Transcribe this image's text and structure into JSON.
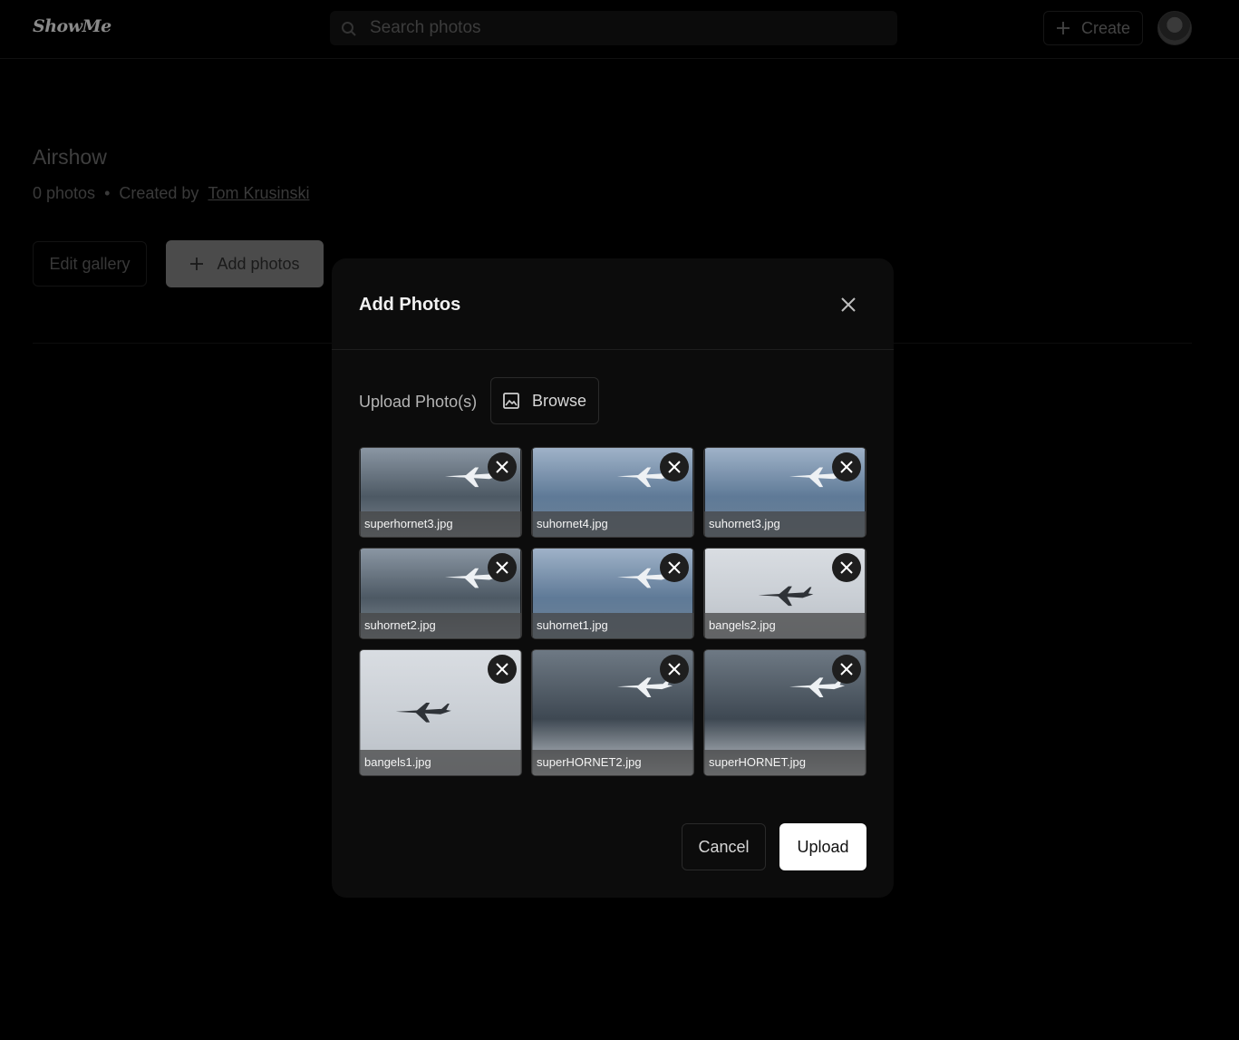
{
  "app": {
    "logo": "ShowMe"
  },
  "header": {
    "search_placeholder": "Search photos",
    "create_label": "Create"
  },
  "gallery": {
    "title": "Airshow",
    "photo_count": "0 photos",
    "separator": "•",
    "created_by_label": "Created by",
    "author": "Tom Krusinski",
    "edit_label": "Edit gallery",
    "add_photos_label": "Add photos"
  },
  "modal": {
    "title": "Add Photos",
    "upload_label": "Upload Photo(s)",
    "browse_label": "Browse",
    "files": [
      {
        "name": "superhornet3.jpg",
        "scene": "dark"
      },
      {
        "name": "suhornet4.jpg",
        "scene": "blue"
      },
      {
        "name": "suhornet3.jpg",
        "scene": "blue"
      },
      {
        "name": "suhornet2.jpg",
        "scene": "dark"
      },
      {
        "name": "suhornet1.jpg",
        "scene": "blue"
      },
      {
        "name": "bangels2.jpg",
        "scene": "light"
      },
      {
        "name": "bangels1.jpg",
        "scene": "light"
      },
      {
        "name": "superHORNET2.jpg",
        "scene": "storm"
      },
      {
        "name": "superHORNET.jpg",
        "scene": "storm"
      }
    ],
    "cancel_label": "Cancel",
    "upload_button_label": "Upload"
  }
}
